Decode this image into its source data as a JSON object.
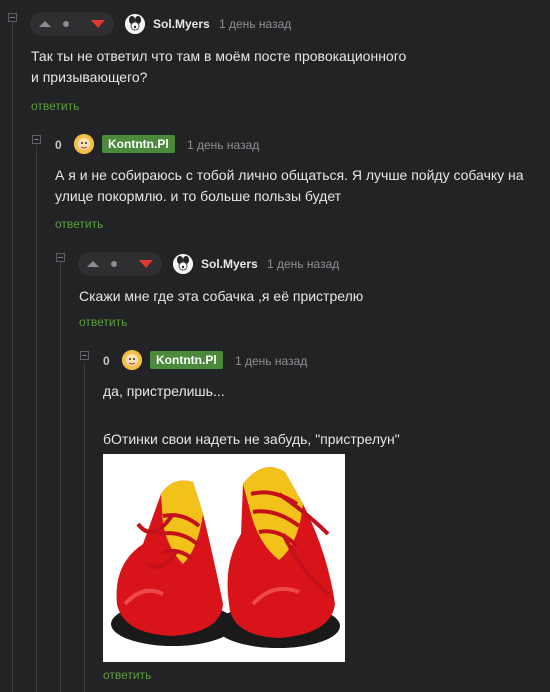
{
  "comments": [
    {
      "user": "Sol.Myers",
      "time": "1 день назад",
      "text": "Так ты не ответил что там в моём посте провокационного\nи призывающего?",
      "reply": "ответить"
    },
    {
      "rating": "0",
      "user": "Kontntn.Pl",
      "time": "1 день назад",
      "text": "А я и не собираюсь с тобой лично общаться. Я лучше пойду собачку на\nулице покормлю. и то больше пользы будет",
      "reply": "ответить"
    },
    {
      "user": "Sol.Myers",
      "time": "1 день назад",
      "text": "Скажи мне где эта собачка ,я её пристрелю",
      "reply": "ответить"
    },
    {
      "rating": "0",
      "user": "Kontntn.Pl",
      "time": "1 день назад",
      "text_line1": "да, пристрелишь...",
      "text_line2": "бОтинки свои надеть не забудь, \"пристрелун\"",
      "reply": "ответить"
    }
  ],
  "icons": {
    "upvote": "upvote-icon",
    "downvote": "downvote-icon",
    "collapse": "collapse-icon",
    "image": "clown-shoes-image"
  },
  "colors": {
    "background": "#222324",
    "reply_link": "#5e9e3f",
    "downvote": "#e03a2e",
    "badge": "#4a8a3a"
  }
}
